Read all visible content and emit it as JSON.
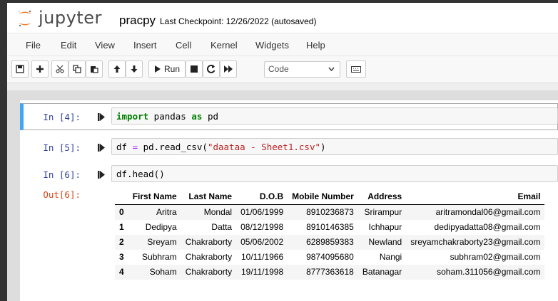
{
  "header": {
    "logo_text": "jupyter",
    "notebook_name": "pracpy",
    "checkpoint": "Last Checkpoint: 12/26/2022  (autosaved)"
  },
  "menu": [
    "File",
    "Edit",
    "View",
    "Insert",
    "Cell",
    "Kernel",
    "Widgets",
    "Help"
  ],
  "toolbar": {
    "run_label": "Run",
    "cell_type": "Code",
    "icons": [
      "save-icon",
      "plus-icon",
      "cut-icon",
      "copy-icon",
      "paste-icon",
      "arrow-up-icon",
      "arrow-down-icon",
      "play-icon",
      "stop-icon",
      "restart-icon",
      "fast-forward-icon",
      "keyboard-icon"
    ]
  },
  "cells": [
    {
      "prompt": "In [4]:",
      "code_kw1": "import",
      "code_mid": " pandas ",
      "code_kw2": "as",
      "code_end": " pd"
    },
    {
      "prompt": "In [5]:",
      "code_a": "df ",
      "code_op": "=",
      "code_b": " pd.read_csv(",
      "code_str": "\"daataa - Sheet1.csv\"",
      "code_c": ")"
    },
    {
      "prompt": "In [6]:",
      "code": "df.head()"
    }
  ],
  "output": {
    "prompt": "Out[6]:",
    "columns": [
      "",
      "First Name",
      "Last Name",
      "D.O.B",
      "Mobile Number",
      "Address",
      "Email"
    ],
    "rows": [
      [
        "0",
        "Aritra",
        "Mondal",
        "01/06/1999",
        "8910236873",
        "Srirampur",
        "aritramondal06@gmail.com"
      ],
      [
        "1",
        "Dedipya",
        "Datta",
        "08/12/1998",
        "8910146385",
        "Ichhapur",
        "dedipyadatta08@gmail.com"
      ],
      [
        "2",
        "Sreyam",
        "Chakraborty",
        "05/06/2002",
        "6289859383",
        "Newland",
        "sreyamchakraborty23@gmail.com"
      ],
      [
        "3",
        "Subhram",
        "Chakraborty",
        "10/11/1966",
        "9874095680",
        "Nangi",
        "subhram02@gmail.com"
      ],
      [
        "4",
        "Soham",
        "Chakraborty",
        "19/11/1998",
        "8777363618",
        "Batanagar",
        "soham.311056@gmail.com"
      ]
    ]
  },
  "colors": {
    "accent_blue": "#42a5f5",
    "prompt_in": "#303f9f",
    "prompt_out": "#d84315",
    "logo_orange": "#f37726"
  }
}
